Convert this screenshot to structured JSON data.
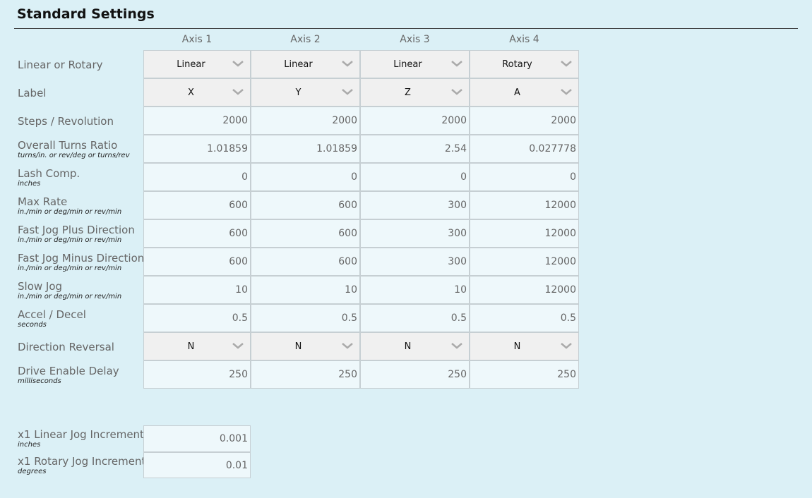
{
  "title": "Standard Settings",
  "axes": [
    "Axis 1",
    "Axis 2",
    "Axis 3",
    "Axis 4"
  ],
  "rows": [
    {
      "label": "Linear or Rotary",
      "sub": "",
      "type": "select",
      "values": [
        "Linear",
        "Linear",
        "Linear",
        "Rotary"
      ]
    },
    {
      "label": "Label",
      "sub": "",
      "type": "select",
      "values": [
        "X",
        "Y",
        "Z",
        "A"
      ]
    },
    {
      "label": "Steps / Revolution",
      "sub": "",
      "type": "input",
      "values": [
        "2000",
        "2000",
        "2000",
        "2000"
      ]
    },
    {
      "label": "Overall Turns Ratio",
      "sub": "turns/in. or rev/deg or turns/rev",
      "type": "input",
      "values": [
        "1.01859",
        "1.01859",
        "2.54",
        "0.027778"
      ]
    },
    {
      "label": "Lash Comp.",
      "sub": "inches",
      "type": "input",
      "values": [
        "0",
        "0",
        "0",
        "0"
      ]
    },
    {
      "label": "Max Rate",
      "sub": "in./min or deg/min or rev/min",
      "type": "input",
      "values": [
        "600",
        "600",
        "300",
        "12000"
      ]
    },
    {
      "label": "Fast Jog Plus Direction",
      "sub": "in./min or deg/min or rev/min",
      "type": "input",
      "values": [
        "600",
        "600",
        "300",
        "12000"
      ]
    },
    {
      "label": "Fast Jog Minus Direction",
      "sub": "in./min or deg/min or rev/min",
      "type": "input",
      "values": [
        "600",
        "600",
        "300",
        "12000"
      ]
    },
    {
      "label": "Slow Jog",
      "sub": "in./min or deg/min or rev/min",
      "type": "input",
      "values": [
        "10",
        "10",
        "10",
        "12000"
      ]
    },
    {
      "label": "Accel / Decel",
      "sub": "seconds",
      "type": "input",
      "values": [
        "0.5",
        "0.5",
        "0.5",
        "0.5"
      ]
    },
    {
      "label": "Direction Reversal",
      "sub": "",
      "type": "select",
      "values": [
        "N",
        "N",
        "N",
        "N"
      ]
    },
    {
      "label": "Drive Enable Delay",
      "sub": "milliseconds",
      "type": "input",
      "values": [
        "250",
        "250",
        "250",
        "250"
      ]
    }
  ],
  "jog": [
    {
      "label": "x1 Linear Jog Increment",
      "sub": "inches",
      "value": "0.001"
    },
    {
      "label": "x1 Rotary Jog Increment",
      "sub": "degrees",
      "value": "0.01"
    }
  ],
  "icons": {
    "dropdown": "chevron-down-icon"
  },
  "colors": {
    "background": "#dbf0f6",
    "input": "#eef8fb",
    "select": "#f0f0f0",
    "border": "#c6cfd3"
  }
}
